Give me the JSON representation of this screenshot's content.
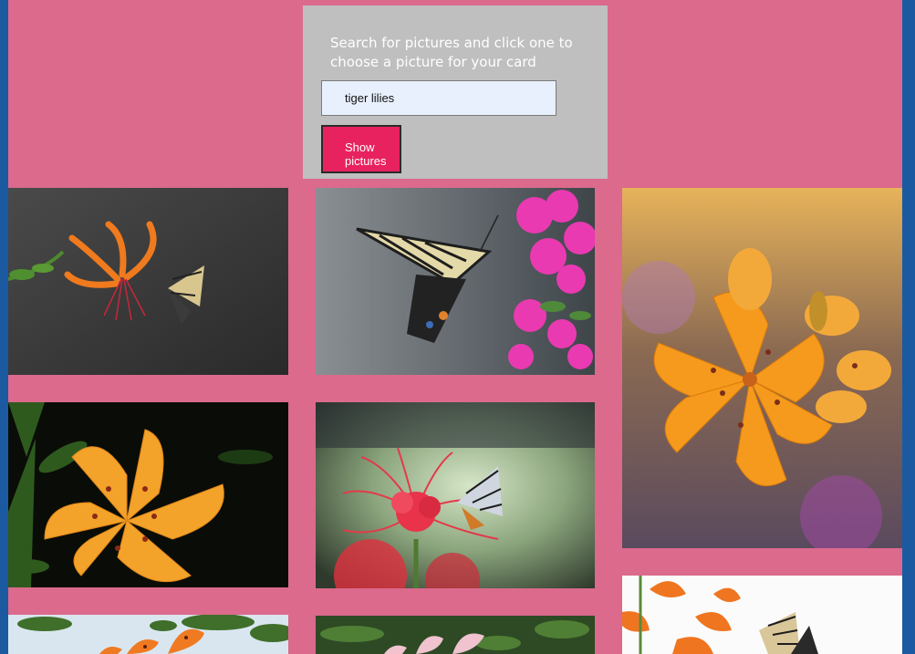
{
  "search": {
    "prompt": "Search for pictures and click one to choose a picture for your card",
    "query": "tiger lilies",
    "button_label": "Show\npictures"
  },
  "colors": {
    "page_background": "#db6a8c",
    "window_edge": "#1b5aa0",
    "panel_background": "#bfbfbf",
    "input_background": "#e8f0fe",
    "button_background": "#e8225f"
  },
  "results": [
    {
      "id": "tiger-lily-swallowtail-dark",
      "subject": "orange tiger lily with swallowtail butterfly on dark background"
    },
    {
      "id": "swallowtail-pink-phlox",
      "subject": "swallowtail butterfly on pink flowers"
    },
    {
      "id": "orange-lily-bouquet",
      "subject": "orange lilies with buds"
    },
    {
      "id": "orange-lily-dark",
      "subject": "orange lily on black background"
    },
    {
      "id": "spider-lily-swallowtail",
      "subject": "red spider lily with swallowtail butterfly"
    },
    {
      "id": "tiger-lily-swallowtail-white",
      "subject": "tiger lily and swallowtail on white background"
    },
    {
      "id": "tiger-lily-sky",
      "subject": "tiger lilies against sky"
    },
    {
      "id": "pink-lily-green",
      "subject": "pink lily among green leaves"
    }
  ]
}
